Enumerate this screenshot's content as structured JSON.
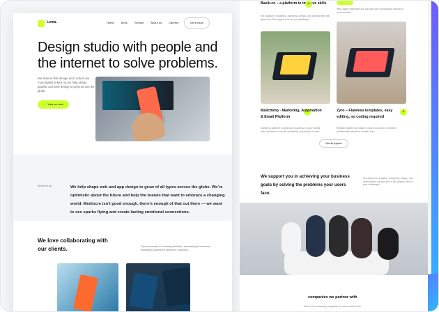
{
  "left_page": {
    "logo_text": "Loma.",
    "nav": {
      "links": [
        "Home",
        "Work",
        "Service",
        "About us",
        "Careers"
      ],
      "cta": "Get in touch"
    },
    "hero": {
      "title": "Design studio with people and the internet to solve problems.",
      "body": "We believe that design and content are more tightly linked, so we help shape graphic and web design to grow across the globe.",
      "button": "View our work"
    },
    "what_we_do": {
      "label": "What we do",
      "text": "We help shape web and app design to grow of all types across the globe. We’re optimistic about the future and help the brands that want to embrace a changing world. Mediocre isn’t good enough, there’s enough of that out there — we want to see sparks flying and create lasting emotional connections."
    },
    "collab": {
      "title": "We love collaborating with our clients.",
      "body": "Experts people in creating websites, developing brands and building eCommerce stores for business."
    }
  },
  "right_page": {
    "top_left_title": "Basik.co – a platform to improve skills",
    "top_left_body": "We organize in analytics, marketing, design, and development will give you a 360-degree view of your challenges.",
    "top_right_body": "With unique templates you can take your productivity, sounds to your business.",
    "cards": [
      {
        "title": "Mailchimp - Marketing, Automation & Email Platform",
        "body": "Marketing platform to grow your business so your brands with Newsletters from the marketing, automation & more."
      },
      {
        "title": "Zyro – Flawless templates, easy editing, no coding required",
        "body": "Website builder that makes it easy for anyone to create a professional website in minutes time."
      }
    ],
    "see_projects": "See all projects",
    "support": {
      "title": "We support you in achieving your business goals by solving the problems your users face.",
      "body": "Our experts in analytics, marketing, design, and development will give you a 360-degree view of your challenges."
    },
    "partners": {
      "title": "companies we partner with",
      "body": "Some of the amazing companies we have worked with"
    }
  },
  "colors": {
    "accent": "#cfff2e",
    "frame_gradient_start": "#6d5cff",
    "frame_gradient_end": "#2fb7ff"
  },
  "icons": {
    "arrow": "→",
    "plus": "+"
  }
}
